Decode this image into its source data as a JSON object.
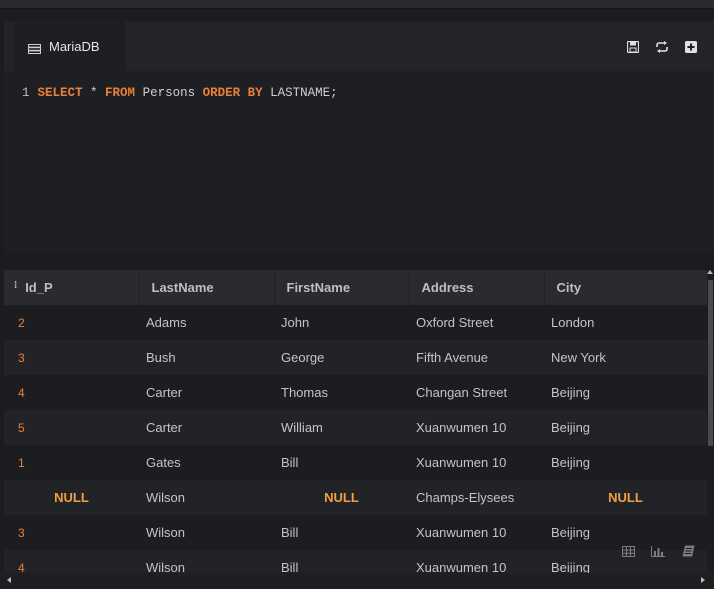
{
  "tab": {
    "title": "MariaDB",
    "icon": "database-icon"
  },
  "toolbar": {
    "icons": [
      "save-icon",
      "refresh-icon",
      "add-icon"
    ]
  },
  "editor": {
    "line_number": "1",
    "tokens": [
      {
        "text": "SELECT",
        "kw": true
      },
      {
        "text": " * ",
        "kw": false
      },
      {
        "text": "FROM",
        "kw": true
      },
      {
        "text": " Persons ",
        "kw": false
      },
      {
        "text": "ORDER BY",
        "kw": true
      },
      {
        "text": " LASTNAME;",
        "kw": false
      }
    ]
  },
  "results": {
    "columns": [
      "Id_P",
      "LastName",
      "FirstName",
      "Address",
      "City"
    ],
    "rows": [
      [
        "2",
        "Adams",
        "John",
        "Oxford Street",
        "London"
      ],
      [
        "3",
        "Bush",
        "George",
        "Fifth Avenue",
        "New York"
      ],
      [
        "4",
        "Carter",
        "Thomas",
        "Changan Street",
        "Beijing"
      ],
      [
        "5",
        "Carter",
        "William",
        "Xuanwumen 10",
        "Beijing"
      ],
      [
        "1",
        "Gates",
        "Bill",
        "Xuanwumen 10",
        "Beijing"
      ],
      [
        "NULL",
        "Wilson",
        "NULL",
        "Champs-Elysees",
        "NULL"
      ],
      [
        "3",
        "Wilson",
        "Bill",
        "Xuanwumen 10",
        "Beijing"
      ],
      [
        "4",
        "Wilson",
        "Bill",
        "Xuanwumen 10",
        "Beijing"
      ]
    ]
  },
  "view_tools": [
    "table-view-icon",
    "chart-view-icon",
    "text-view-icon"
  ],
  "colors": {
    "keyword": "#e8803a",
    "null": "#f0a040",
    "background": "#1b1c1f"
  }
}
